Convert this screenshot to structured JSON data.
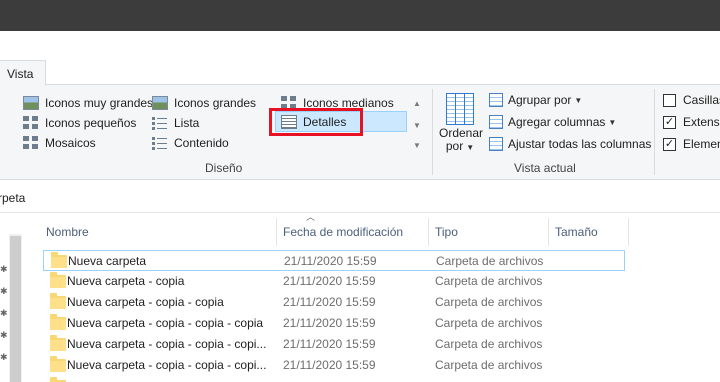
{
  "ribbon": {
    "tab_label": "Vista",
    "layout": {
      "items": [
        {
          "label": "Iconos muy grandes"
        },
        {
          "label": "Iconos grandes"
        },
        {
          "label": "Iconos medianos"
        },
        {
          "label": "Iconos pequeños"
        },
        {
          "label": "Lista"
        },
        {
          "label": "Detalles",
          "selected": true
        },
        {
          "label": "Mosaicos"
        },
        {
          "label": "Contenido"
        }
      ],
      "group_label": "Diseño"
    },
    "current_view": {
      "sort_label_line1": "Ordenar",
      "sort_label_line2": "por",
      "group_by": "Agrupar por",
      "add_columns": "Agregar columnas",
      "fit_columns": "Ajustar todas las columnas",
      "group_label": "Vista actual"
    },
    "show_hide": {
      "items": [
        {
          "label": "Casillas",
          "checked": false
        },
        {
          "label": "Extensi",
          "checked": true
        },
        {
          "label": "Elemen",
          "checked": true
        }
      ]
    }
  },
  "address": {
    "path": "rpeta"
  },
  "columns": {
    "name": "Nombre",
    "date": "Fecha de modificación",
    "type": "Tipo",
    "size": "Tamaño"
  },
  "files": [
    {
      "name": "Nueva carpeta",
      "date": "21/11/2020 15:59",
      "type": "Carpeta de archivos"
    },
    {
      "name": "Nueva carpeta - copia",
      "date": "21/11/2020 15:59",
      "type": "Carpeta de archivos"
    },
    {
      "name": "Nueva carpeta - copia - copia",
      "date": "21/11/2020 15:59",
      "type": "Carpeta de archivos"
    },
    {
      "name": "Nueva carpeta - copia - copia - copia",
      "date": "21/11/2020 15:59",
      "type": "Carpeta de archivos"
    },
    {
      "name": "Nueva carpeta - copia - copia - copi...",
      "date": "21/11/2020 15:59",
      "type": "Carpeta de archivos"
    },
    {
      "name": "Nueva carpeta - copia - copia - copi...",
      "date": "21/11/2020 15:59",
      "type": "Carpeta de archivos"
    }
  ],
  "colors": {
    "highlight": "#e81123",
    "selection": "#cce8ff",
    "titlebar": "#3c3c3c"
  }
}
